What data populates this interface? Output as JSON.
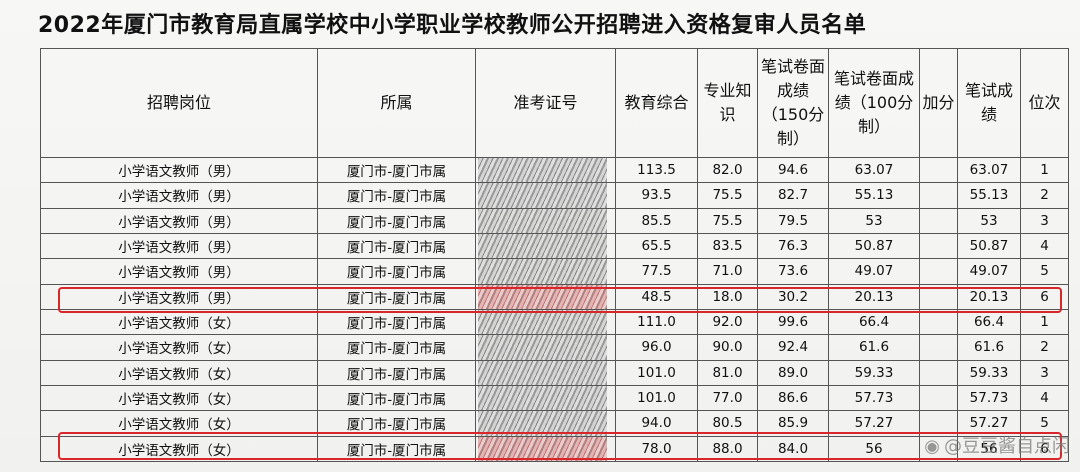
{
  "title": "2022年厦门市教育局直属学校中小学职业学校教师公开招聘进入资格复审人员名单",
  "headers": {
    "position": "招聘岗位",
    "affiliation": "所属",
    "exam_id": "准考证号",
    "edu_comprehensive": "教育综合",
    "major_knowledge": "专业知识",
    "written_raw": "笔试卷面成绩（150分制）",
    "written_100": "笔试卷面成绩（100分制）",
    "bonus": "加分",
    "written_score": "笔试成绩",
    "rank": "位次"
  },
  "rows": [
    {
      "position": "小学语文教师（男）",
      "affiliation": "厦门市-厦门市属",
      "edu": "113.5",
      "major": "82.0",
      "raw150": "94.6",
      "score100": "63.07",
      "bonus": "",
      "written": "63.07",
      "rank": "1"
    },
    {
      "position": "小学语文教师（男）",
      "affiliation": "厦门市-厦门市属",
      "edu": "93.5",
      "major": "75.5",
      "raw150": "82.7",
      "score100": "55.13",
      "bonus": "",
      "written": "55.13",
      "rank": "2"
    },
    {
      "position": "小学语文教师（男）",
      "affiliation": "厦门市-厦门市属",
      "edu": "85.5",
      "major": "75.5",
      "raw150": "79.5",
      "score100": "53",
      "bonus": "",
      "written": "53",
      "rank": "3"
    },
    {
      "position": "小学语文教师（男）",
      "affiliation": "厦门市-厦门市属",
      "edu": "65.5",
      "major": "83.5",
      "raw150": "76.3",
      "score100": "50.87",
      "bonus": "",
      "written": "50.87",
      "rank": "4"
    },
    {
      "position": "小学语文教师（男）",
      "affiliation": "厦门市-厦门市属",
      "edu": "77.5",
      "major": "71.0",
      "raw150": "73.6",
      "score100": "49.07",
      "bonus": "",
      "written": "49.07",
      "rank": "5"
    },
    {
      "position": "小学语文教师（男）",
      "affiliation": "厦门市-厦门市属",
      "edu": "48.5",
      "major": "18.0",
      "raw150": "30.2",
      "score100": "20.13",
      "bonus": "",
      "written": "20.13",
      "rank": "6"
    },
    {
      "position": "小学语文教师（女）",
      "affiliation": "厦门市-厦门市属",
      "edu": "111.0",
      "major": "92.0",
      "raw150": "99.6",
      "score100": "66.4",
      "bonus": "",
      "written": "66.4",
      "rank": "1"
    },
    {
      "position": "小学语文教师（女）",
      "affiliation": "厦门市-厦门市属",
      "edu": "96.0",
      "major": "90.0",
      "raw150": "92.4",
      "score100": "61.6",
      "bonus": "",
      "written": "61.6",
      "rank": "2"
    },
    {
      "position": "小学语文教师（女）",
      "affiliation": "厦门市-厦门市属",
      "edu": "101.0",
      "major": "81.0",
      "raw150": "89.0",
      "score100": "59.33",
      "bonus": "",
      "written": "59.33",
      "rank": "3"
    },
    {
      "position": "小学语文教师（女）",
      "affiliation": "厦门市-厦门市属",
      "edu": "101.0",
      "major": "77.0",
      "raw150": "86.6",
      "score100": "57.73",
      "bonus": "",
      "written": "57.73",
      "rank": "4"
    },
    {
      "position": "小学语文教师（女）",
      "affiliation": "厦门市-厦门市属",
      "edu": "94.0",
      "major": "80.5",
      "raw150": "85.9",
      "score100": "57.27",
      "bonus": "",
      "written": "57.27",
      "rank": "5"
    },
    {
      "position": "小学语文教师（女）",
      "affiliation": "厦门市-厦门市属",
      "edu": "78.0",
      "major": "88.0",
      "raw150": "84.0",
      "score100": "56",
      "bonus": "",
      "written": "56",
      "rank": "6"
    }
  ],
  "watermark": "@豆豆酱自点闲",
  "highlight_color": "#d9262a"
}
